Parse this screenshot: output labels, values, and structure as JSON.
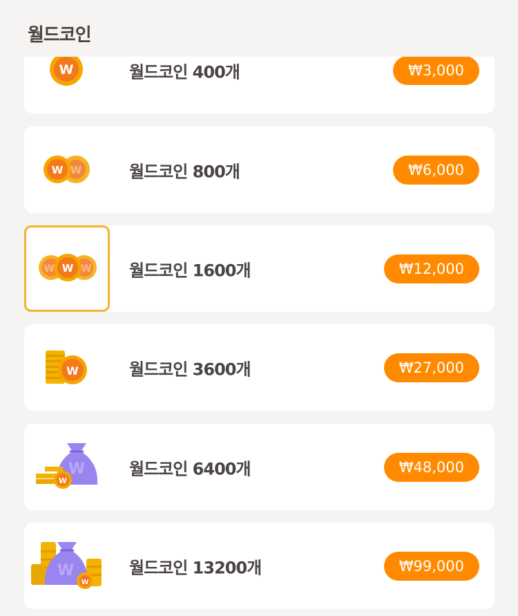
{
  "header": {
    "title": "월드코인"
  },
  "colors": {
    "background": "#f6f4f3",
    "card": "#ffffff",
    "price_button": "#ff8a00",
    "selected_border": "#f4b22f",
    "coin": "#f7a500",
    "coin_face": "#f27a1a",
    "bag": "#9a84f0"
  },
  "products": [
    {
      "name": "월드코인 400개",
      "price": "₩3,000",
      "icon": "single-coin-icon",
      "selected": false
    },
    {
      "name": "월드코인 800개",
      "price": "₩6,000",
      "icon": "two-coins-icon",
      "selected": false
    },
    {
      "name": "월드코인 1600개",
      "price": "₩12,000",
      "icon": "three-coins-icon",
      "selected": true
    },
    {
      "name": "월드코인 3600개",
      "price": "₩27,000",
      "icon": "coin-stack-icon",
      "selected": false
    },
    {
      "name": "월드코인 6400개",
      "price": "₩48,000",
      "icon": "coin-bag-icon",
      "selected": false
    },
    {
      "name": "월드코인 13200개",
      "price": "₩99,000",
      "icon": "coin-bag-pile-icon",
      "selected": false
    }
  ],
  "coin_letter": "W"
}
